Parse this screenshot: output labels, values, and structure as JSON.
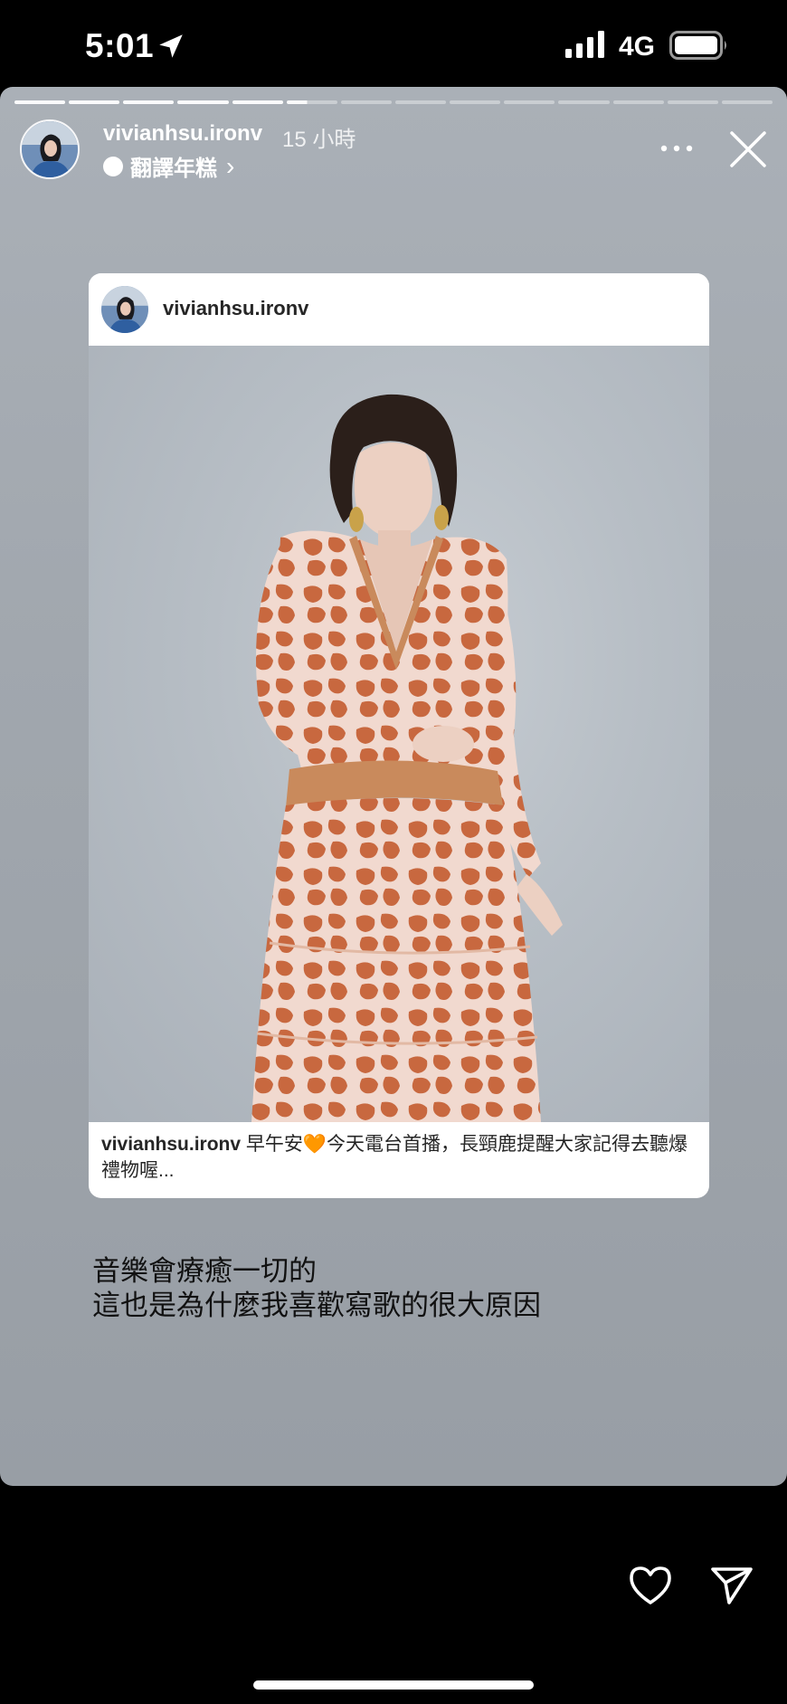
{
  "status_bar": {
    "time": "5:01",
    "network": "4G",
    "icons": [
      "location-arrow-icon",
      "cellular-signal-icon",
      "battery-icon"
    ]
  },
  "story": {
    "progress": {
      "segments": 14,
      "completed": 5,
      "current_fraction": 0.4
    },
    "header": {
      "username": "vivianhsu.ironv",
      "time_ago": "15 小時",
      "audio_label": "翻譯年糕",
      "audio_chevron": "›"
    },
    "shared_post": {
      "username": "vivianhsu.ironv",
      "caption_user": "vivianhsu.ironv",
      "caption_text": " 早午安🧡今天電台首播，長頸鹿提醒大家記得去聽爆禮物喔..."
    },
    "text_lines": [
      "音樂會療癒一切的",
      "這也是為什麼我喜歡寫歌的很大原因"
    ]
  },
  "bottom_bar": {
    "icons": [
      "heart-icon",
      "send-icon"
    ]
  },
  "colors": {
    "story_bg": "#a1a7ae",
    "dress": "#c8683f",
    "dress_base": "#f1d9cf"
  }
}
